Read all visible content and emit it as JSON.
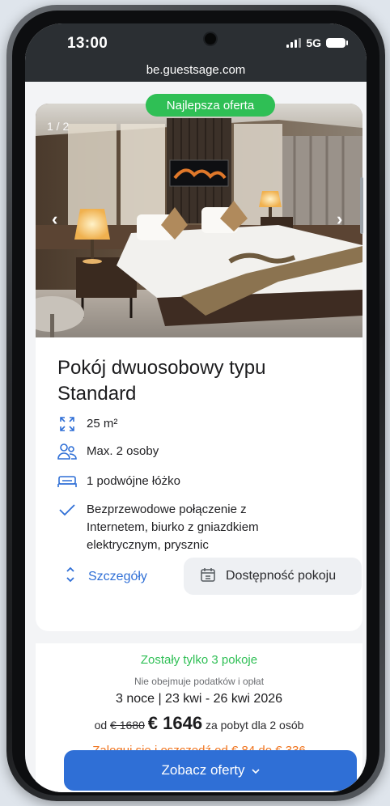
{
  "status_bar": {
    "time": "13:00",
    "network": "5G",
    "icons": [
      "signal-icon",
      "battery-icon"
    ]
  },
  "browser": {
    "url": "be.guestsage.com"
  },
  "room": {
    "badge": "Najlepsza oferta",
    "photo_counter": "1 / 2",
    "title": "Pokój dwuosobowy typu Standard",
    "features": [
      {
        "icon": "expand-arrows-icon",
        "text": "25 m²"
      },
      {
        "icon": "people-icon",
        "text": "Max. 2 osoby"
      },
      {
        "icon": "bed-icon",
        "text": "1 podwójne łóżko"
      },
      {
        "icon": "check-icon",
        "text": "Bezprzewodowe połączenie z Internetem, biurko z gniazdkiem elektrycznym, prysznic"
      }
    ],
    "details_label": "Szczegóły",
    "availability_label": "Dostępność pokoju"
  },
  "pricing": {
    "rooms_left": "Zostały tylko 3 pokoje",
    "tax_note": "Nie obejmuje podatków i opłat",
    "dates": "3 noce | 23 kwi - 26 kwi 2026",
    "prefix": "od",
    "old_price": "€ 1680",
    "new_price": "€ 1646",
    "suffix": "za pobyt dla 2 osób",
    "login_offer": "Zaloguj się i oszczędź od € 84 do € 336",
    "cta": "Zobacz oferty"
  },
  "colors": {
    "accent_blue": "#2f6fd6",
    "success_green": "#2fbf55",
    "warning_orange": "#f0741e",
    "status_bar": "#2b2f33"
  }
}
